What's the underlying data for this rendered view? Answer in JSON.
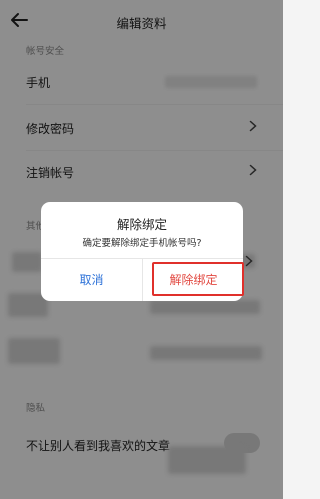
{
  "header": {
    "title": "编辑资料"
  },
  "sections": {
    "account_security_label": "帐号安全",
    "other_label": "其他",
    "privacy_label": "隐私"
  },
  "rows": {
    "phone": "手机",
    "change_password": "修改密码",
    "cancel_account": "注销帐号",
    "privacy_option": "不让别人看到我喜欢的文章"
  },
  "dialog": {
    "title": "解除绑定",
    "message": "确定要解除绑定手机帐号吗?",
    "cancel_label": "取消",
    "confirm_label": "解除绑定"
  },
  "colors": {
    "accent_blue": "#2f73d8",
    "confirm_red": "#e24a42",
    "highlight_red": "#e0302b"
  },
  "icons": {
    "back": "back-arrow-icon",
    "chevron": "chevron-right-icon"
  }
}
